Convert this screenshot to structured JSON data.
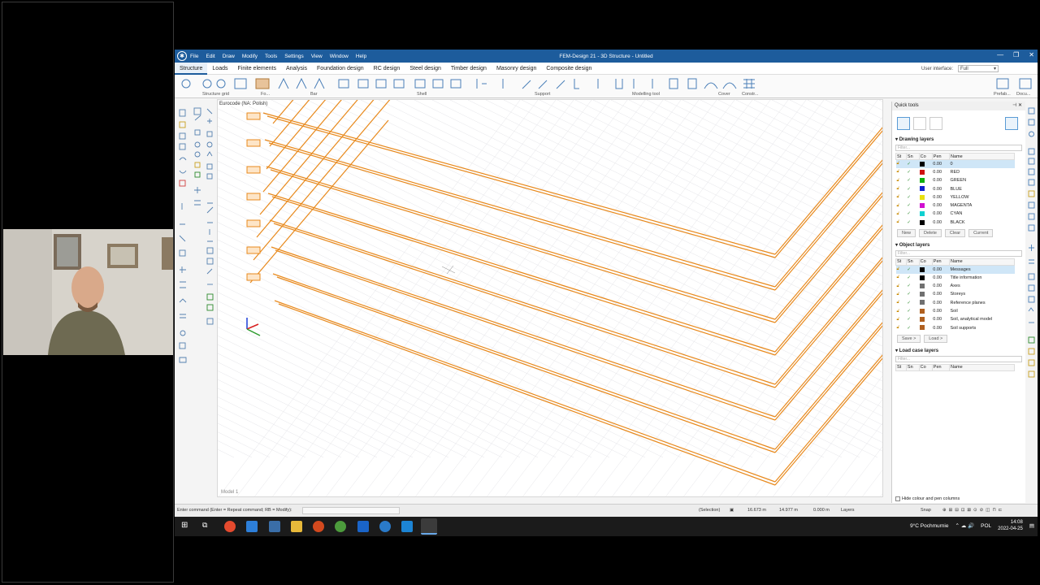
{
  "window": {
    "title": "FEM-Design 21 - 3D Structure - Untitled",
    "menu": [
      "File",
      "Edit",
      "Draw",
      "Modify",
      "Tools",
      "Settings",
      "View",
      "Window",
      "Help"
    ]
  },
  "ribbon": {
    "tabs": [
      "Structure",
      "Loads",
      "Finite elements",
      "Analysis",
      "Foundation design",
      "RC design",
      "Steel design",
      "Timber design",
      "Masonry design",
      "Composite design"
    ],
    "active_tab": "Structure",
    "user_interface_label": "User interface:",
    "user_interface_value": "Full",
    "groups": [
      "Structure grid",
      "Fo...",
      "Bar",
      "Shell",
      "Support",
      "Modelling tool",
      "Cover",
      "Constr...",
      "Prefab...",
      "Docu..."
    ]
  },
  "viewport": {
    "code_label": "Eurocode (NA: Polish)",
    "model_tab": "Model 1"
  },
  "quick_tools": {
    "title": "Quick tools",
    "drawing_layers": {
      "title": "Drawing layers",
      "filter_placeholder": "Filter...",
      "columns": [
        "St",
        "Sn",
        "Co",
        "Pen",
        "Name"
      ],
      "rows": [
        {
          "pen": "0.00",
          "name": "0",
          "color": "#000000"
        },
        {
          "pen": "0.00",
          "name": "RED",
          "color": "#d01010"
        },
        {
          "pen": "0.00",
          "name": "GREEN",
          "color": "#10b010"
        },
        {
          "pen": "0.00",
          "name": "BLUE",
          "color": "#1020d0"
        },
        {
          "pen": "0.00",
          "name": "YELLOW",
          "color": "#e8e010"
        },
        {
          "pen": "0.00",
          "name": "MAGENTA",
          "color": "#d010d0"
        },
        {
          "pen": "0.00",
          "name": "CYAN",
          "color": "#10d0d0"
        },
        {
          "pen": "0.00",
          "name": "BLACK",
          "color": "#000000"
        }
      ],
      "buttons": [
        "New",
        "Delete",
        "Clear",
        "Current"
      ]
    },
    "object_layers": {
      "title": "Object layers",
      "filter_placeholder": "Filter...",
      "columns": [
        "St",
        "Sn",
        "Co",
        "Pen",
        "Name"
      ],
      "rows": [
        {
          "pen": "0.00",
          "name": "Messages",
          "color": "#000000"
        },
        {
          "pen": "0.00",
          "name": "Title information",
          "color": "#000000"
        },
        {
          "pen": "0.00",
          "name": "Axes",
          "color": "#707070"
        },
        {
          "pen": "0.00",
          "name": "Storeys",
          "color": "#707070"
        },
        {
          "pen": "0.00",
          "name": "Reference planes",
          "color": "#707070"
        },
        {
          "pen": "0.00",
          "name": "Soil",
          "color": "#b06020"
        },
        {
          "pen": "0.00",
          "name": "Soil, analytical model",
          "color": "#b06020"
        },
        {
          "pen": "0.00",
          "name": "Soil supports",
          "color": "#b06020"
        }
      ],
      "buttons": [
        "Save >",
        "Load >"
      ]
    },
    "load_case_layers": {
      "title": "Load case layers",
      "filter_placeholder": "Filter...",
      "columns": [
        "St",
        "Sn",
        "Co",
        "Pen",
        "Name"
      ]
    },
    "hide_columns_label": "Hide colour and pen columns"
  },
  "status": {
    "command_prompt": "Enter command (Enter = Repeat command; RB = Modify):",
    "selection": "(Selection)",
    "x": "16.673 m",
    "y": "14.977 m",
    "z": "0.000 m",
    "layers": "Layers",
    "snap": "Snap"
  },
  "taskbar": {
    "weather": "9°C Pochmurnie",
    "language": "POL",
    "time": "14:08",
    "date": "2022-04-25"
  },
  "colors": {
    "title_blue": "#1d5c9c",
    "beam_orange": "#e8891c"
  }
}
